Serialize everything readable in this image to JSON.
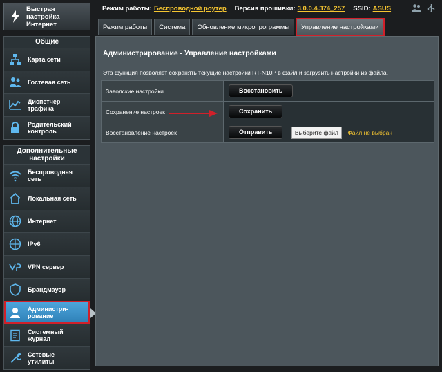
{
  "quick_setup": {
    "label_line1": "Быстрая настройка",
    "label_line2": "Интернет"
  },
  "sidebar": {
    "general": {
      "title": "Общие",
      "items": [
        {
          "icon": "network-map-icon",
          "label_line1": "Карта сети",
          "label_line2": ""
        },
        {
          "icon": "guest-network-icon",
          "label_line1": "Гостевая сеть",
          "label_line2": ""
        },
        {
          "icon": "traffic-manager-icon",
          "label_line1": "Диспетчер",
          "label_line2": "трафика"
        },
        {
          "icon": "parental-control-icon",
          "label_line1": "Родительский",
          "label_line2": "контроль"
        }
      ]
    },
    "advanced": {
      "title_line1": "Дополнительные",
      "title_line2": "настройки",
      "items": [
        {
          "icon": "wireless-icon",
          "label_line1": "Беспроводная",
          "label_line2": "сеть"
        },
        {
          "icon": "lan-icon",
          "label_line1": "Локальная сеть",
          "label_line2": ""
        },
        {
          "icon": "internet-globe-icon",
          "label_line1": "Интернет",
          "label_line2": ""
        },
        {
          "icon": "ipv6-icon",
          "label_line1": "IPv6",
          "label_line2": ""
        },
        {
          "icon": "vpn-icon",
          "label_line1": "VPN сервер",
          "label_line2": ""
        },
        {
          "icon": "firewall-icon",
          "label_line1": "Брандмауэр",
          "label_line2": ""
        },
        {
          "icon": "administration-icon",
          "label_line1": "Администри-",
          "label_line2": "рование"
        },
        {
          "icon": "system-log-icon",
          "label_line1": "Системный",
          "label_line2": "журнал"
        },
        {
          "icon": "network-tools-icon",
          "label_line1": "Сетевые",
          "label_line2": "утилиты"
        }
      ],
      "active_index": 6
    }
  },
  "topbar": {
    "mode_label": "Режим работы:",
    "mode_value": "Беспроводной роутер",
    "firmware_label": "Версия прошивки:",
    "firmware_value": "3.0.0.4.374_257",
    "ssid_label": "SSID:",
    "ssid_value": "ASUS"
  },
  "tabs": [
    {
      "label": "Режим работы"
    },
    {
      "label": "Система"
    },
    {
      "label": "Обновление микропрограммы"
    },
    {
      "label": "Управление настройками"
    }
  ],
  "active_tab": 3,
  "main": {
    "title": "Администрирование - Управление настройками",
    "description": "Эта функция позволяет сохранять текущие настройки RT-N10P в файл и загрузить настройки из файла.",
    "rows": [
      {
        "label": "Заводские настройки",
        "button": "Восстановить"
      },
      {
        "label": "Сохранение настроек",
        "button": "Сохранить"
      },
      {
        "label": "Восстановление настроек",
        "button": "Отправить",
        "file_button": "Выберите файл",
        "file_status": "Файл не выбран"
      }
    ]
  },
  "colors": {
    "accent_yellow": "#f5c531",
    "highlight_red": "#d0202a",
    "active_blue": "#3a92cc"
  }
}
